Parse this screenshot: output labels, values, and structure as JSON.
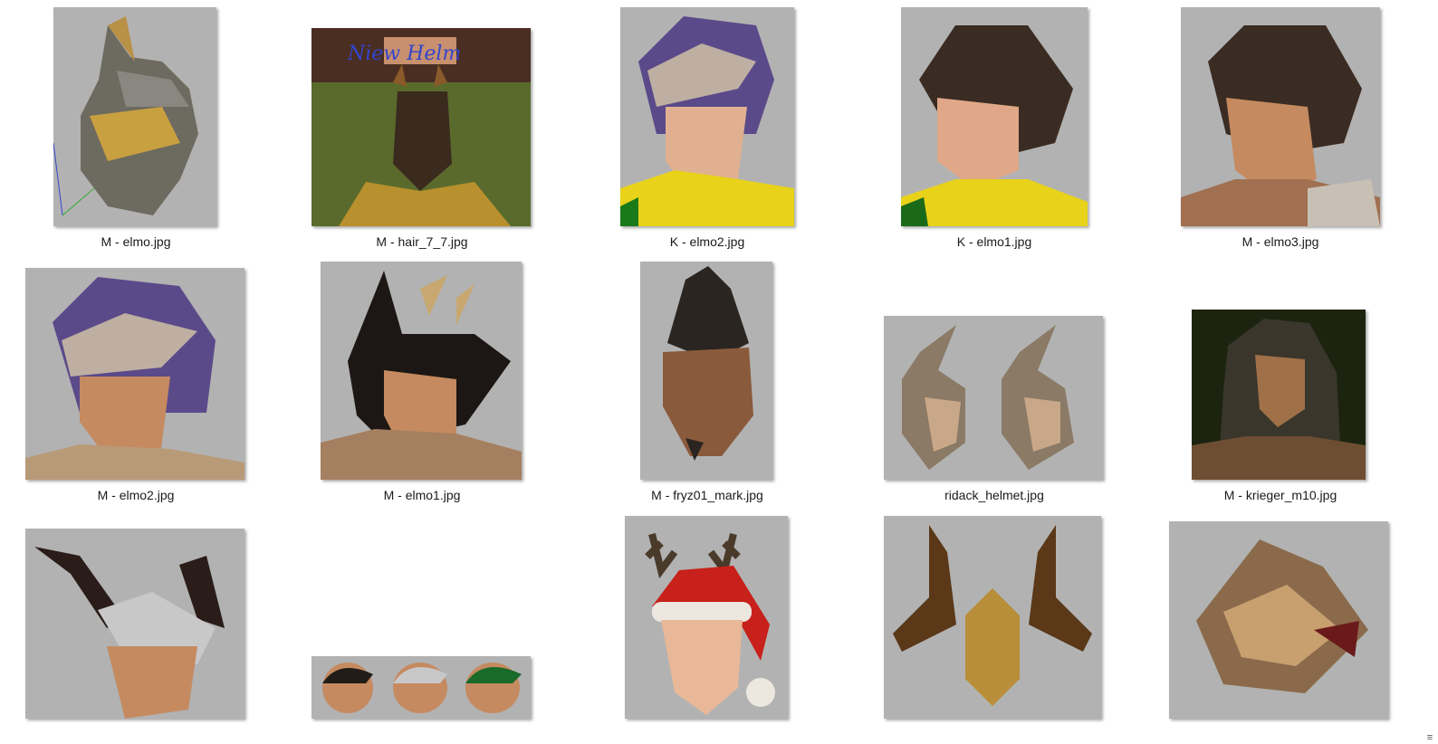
{
  "gallery": {
    "items": [
      {
        "filename": "M - elmo.jpg",
        "icon": "golden-knight-helmet-icon"
      },
      {
        "filename": "M - hair_7_7.jpg",
        "icon": "horned-warrior-in-armor-icon"
      },
      {
        "filename": "K - elmo2.jpg",
        "icon": "purple-helmet-female-icon"
      },
      {
        "filename": "K - elmo1.jpg",
        "icon": "dark-helmet-female-icon"
      },
      {
        "filename": "M - elmo3.jpg",
        "icon": "dark-helmet-male-icon"
      },
      {
        "filename": "M - elmo2.jpg",
        "icon": "purple-helmet-male-icon"
      },
      {
        "filename": "M - elmo1.jpg",
        "icon": "black-horned-helmet-male-icon"
      },
      {
        "filename": "M - fryz01_mark.jpg",
        "icon": "mohawk-head-icon"
      },
      {
        "filename": "ridack_helmet.jpg",
        "icon": "twin-winged-helmets-icon"
      },
      {
        "filename": "M - krieger_m10.jpg",
        "icon": "long-hair-warrior-icon"
      },
      {
        "filename": "",
        "icon": "silver-hair-horns-head-icon"
      },
      {
        "filename": "",
        "icon": "three-hair-colors-heads-icon"
      },
      {
        "filename": "",
        "icon": "santa-hat-antlers-head-icon"
      },
      {
        "filename": "",
        "icon": "horned-golden-helmet-icon"
      },
      {
        "filename": "",
        "icon": "patterned-dragon-helmet-icon"
      }
    ],
    "thumb_bg": "#b2b2b2",
    "resize_grip_glyph": "≡"
  }
}
